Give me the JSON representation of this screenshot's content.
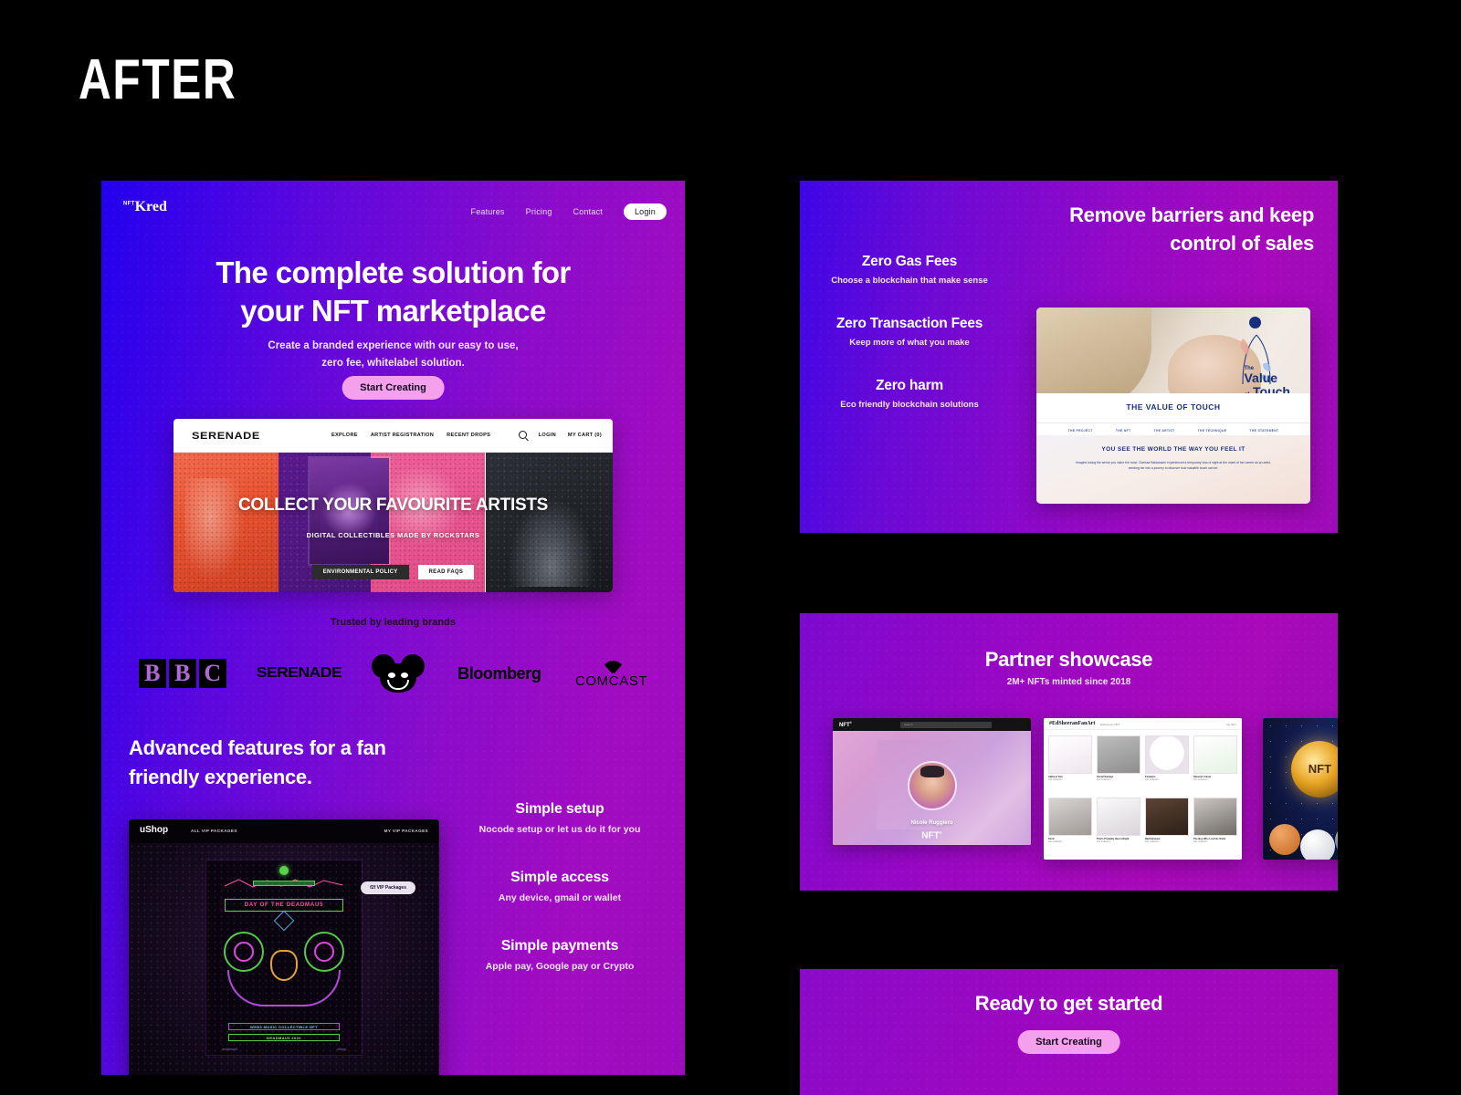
{
  "page": {
    "title": "AFTER"
  },
  "hero": {
    "logo": {
      "sup": "NFT",
      "name": "Kred"
    },
    "nav": [
      {
        "label": "Features"
      },
      {
        "label": "Pricing"
      },
      {
        "label": "Contact"
      }
    ],
    "login_label": "Login",
    "headline_line1": "The complete solution for",
    "headline_line2": "your NFT marketplace",
    "sub_line1": "Create a branded experience with our easy to use,",
    "sub_line2": "zero fee, whitelabel solution.",
    "cta_label": "Start Creating"
  },
  "serenade_mockup": {
    "logo": "SERENADE",
    "nav": [
      "EXPLORE",
      "ARTIST REGISTRATION",
      "RECENT DROPS"
    ],
    "login": "LOGIN",
    "cart": "MY CART (0)",
    "banner_title": "COLLECT YOUR FAVOURITE ARTISTS",
    "banner_sub": "DIGITAL COLLECTIBLES MADE BY ROCKSTARS",
    "btn_policy": "ENVIRONMENTAL POLICY",
    "btn_faqs": "READ FAQS"
  },
  "trusted": {
    "label": "Trusted by leading brands",
    "brands": [
      "BBC",
      "SERENADE",
      "deadmau5",
      "Bloomberg",
      "COMCAST"
    ]
  },
  "advanced": {
    "heading_line1": "Advanced features for a fan",
    "heading_line2": "friendly experience.",
    "features": [
      {
        "title": "Simple setup",
        "desc": "Nocode setup or let us do it for you"
      },
      {
        "title": "Simple access",
        "desc": "Any device, gmail or wallet"
      },
      {
        "title": "Simple payments",
        "desc": "Apple pay, Google pay or Crypto"
      }
    ]
  },
  "ushop_mockup": {
    "logo": "uShop",
    "nav_left": "ALL VIP PACKAGES",
    "nav_right": "MY VIP PACKAGES",
    "pill": "f2f VIP Packages",
    "poster_title": "DAY OF THE DEADMAU5",
    "poster_line1": "WEB3 MUSIC COLLECTIBLE NFT",
    "poster_line2": "DEADMAU5 2022",
    "poster_foot_left": "deadmau5",
    "poster_foot_right": "uShop"
  },
  "barriers": {
    "heading_line1": "Remove barriers and keep",
    "heading_line2": "control of sales",
    "items": [
      {
        "title": "Zero Gas Fees",
        "desc": "Choose a blockchain that make sense"
      },
      {
        "title": "Zero Transaction Fees",
        "desc": "Keep more of what you make"
      },
      {
        "title": "Zero harm",
        "desc": "Eco friendly blockchain solutions"
      }
    ]
  },
  "value_mockup": {
    "brand_small": "The",
    "brand_line1": "Value",
    "brand_of": "of",
    "brand_line2": "Touch",
    "heading": "THE VALUE OF TOUCH",
    "nav": [
      "THE PROJECT",
      "THE NFT",
      "THE ARTIST",
      "THE TECHNIQUE",
      "THE STATEMENT"
    ],
    "subheading": "YOU SEE THE WORLD THE WAY YOU FEEL IT",
    "body": "Imagine losing the sense you value the most. Clarissa Baldassarri experienced a temporary loss of sight at the onset of her career as an artist, sending her into a journey to discover how valuable touch can be."
  },
  "showcase": {
    "heading": "Partner showcase",
    "sub": "2M+ NFTs minted since 2018",
    "card_a": {
      "logo": "NFT",
      "logo_sup": "®",
      "search_placeholder": "Search",
      "artist_name": "Nicole Ruggiero",
      "brand": "NFT",
      "brand_sup": "®"
    },
    "card_b": {
      "logo": "#EdSheeranFanArt",
      "sub": "Edsheeran NFT",
      "right": "My NFT",
      "tiles": [
        {
          "title": "Abbie & Tom",
          "artist": "Fan Collection"
        },
        {
          "title": "Social Savings",
          "artist": "Fan Collection"
        },
        {
          "title": "Fantastic",
          "artist": "Fan Collection"
        },
        {
          "title": "Sheeran Colour",
          "artist": "Fan Collection"
        },
        {
          "title": "Scott",
          "artist": "Fan Collection"
        },
        {
          "title": "That's Probably Been Alright",
          "artist": "Fan Collection"
        },
        {
          "title": "Bartholomew",
          "artist": "Fan Collection"
        },
        {
          "title": "The Boy Who Lost His Smile",
          "artist": "Fan Collection"
        }
      ]
    },
    "card_c": {
      "coin_label": "NFT"
    }
  },
  "ready": {
    "heading": "Ready to get started",
    "cta_label": "Start Creating"
  },
  "colors": {
    "accent_pink": "#f4a0ec",
    "gradient_start": "#2200ee",
    "gradient_end": "#a20cc0",
    "background": "#000000"
  }
}
